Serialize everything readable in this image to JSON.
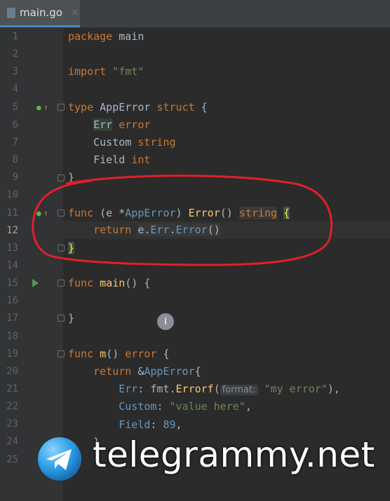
{
  "tab": {
    "filename": "main.go",
    "close_label": "×"
  },
  "lines": [
    {
      "n": "1"
    },
    {
      "n": "2"
    },
    {
      "n": "3"
    },
    {
      "n": "4"
    },
    {
      "n": "5"
    },
    {
      "n": "6"
    },
    {
      "n": "7"
    },
    {
      "n": "8"
    },
    {
      "n": "9"
    },
    {
      "n": "10"
    },
    {
      "n": "11"
    },
    {
      "n": "12"
    },
    {
      "n": "13"
    },
    {
      "n": "14"
    },
    {
      "n": "15"
    },
    {
      "n": "16"
    },
    {
      "n": "17"
    },
    {
      "n": "18"
    },
    {
      "n": "19"
    },
    {
      "n": "20"
    },
    {
      "n": "21"
    },
    {
      "n": "22"
    },
    {
      "n": "23"
    },
    {
      "n": "24"
    },
    {
      "n": "25"
    }
  ],
  "code": {
    "l1_a": "package",
    " l1_b": "",
    "l1_pkg": "main",
    "l3_import": "import",
    "l3_str": "\"fmt\"",
    "l5_type": "type",
    "l5_name": "AppError",
    "l5_struct": "struct",
    "l5_brace": "{",
    "l6_field": "Err",
    "l6_type": "error",
    "l7_field": "Custom",
    "l7_type": "string",
    "l8_field": "Field",
    "l8_type": "int",
    "l9_close": "}",
    "l11_func": "func",
    "l11_recv_open": "(e *",
    "l11_recv_type": "AppError",
    "l11_recv_close": ")",
    "l11_name": "Error",
    "l11_parens": "()",
    "l11_ret": "string",
    "l11_brace": "{",
    "l12_return": "return",
    "l12_expr_a": "e.",
    "l12_expr_b": "Err",
    "l12_expr_c": ".",
    "l12_expr_d": "Error",
    "l12_expr_e": "()",
    "l13_close": "}",
    "l15_func": "func",
    "l15_name": "main",
    "l15_rest": "() {",
    "l17_close": "}",
    "l19_func": "func",
    "l19_name": "m",
    "l19_rest": "() ",
    "l19_ret": "error",
    "l19_brace": " {",
    "l20_return": "return",
    "l20_amp": "&",
    "l20_type": "AppError",
    "l20_brace": "{",
    "l21_key": "Err",
    "l21_sep": ": fmt.",
    "l21_fn": "Errorf",
    "l21_open": "(",
    "l21_hint": "format:",
    "l21_str": "\"my error\"",
    "l21_close": "),",
    "l22_key": "Custom",
    "l22_sep": ": ",
    "l22_str": "\"value here\"",
    "l22_comma": ",",
    "l23_key": "Field",
    "l23_sep": ": ",
    "l23_num": "89",
    "l23_comma": ",",
    "l24_close": "}"
  },
  "watermark": {
    "text": "telegrammy.net"
  },
  "colors": {
    "keyword": "#cc7832",
    "type": "#6897bb",
    "string": "#6a8759",
    "function": "#ffc66d",
    "annotation_red": "#e0202a"
  }
}
